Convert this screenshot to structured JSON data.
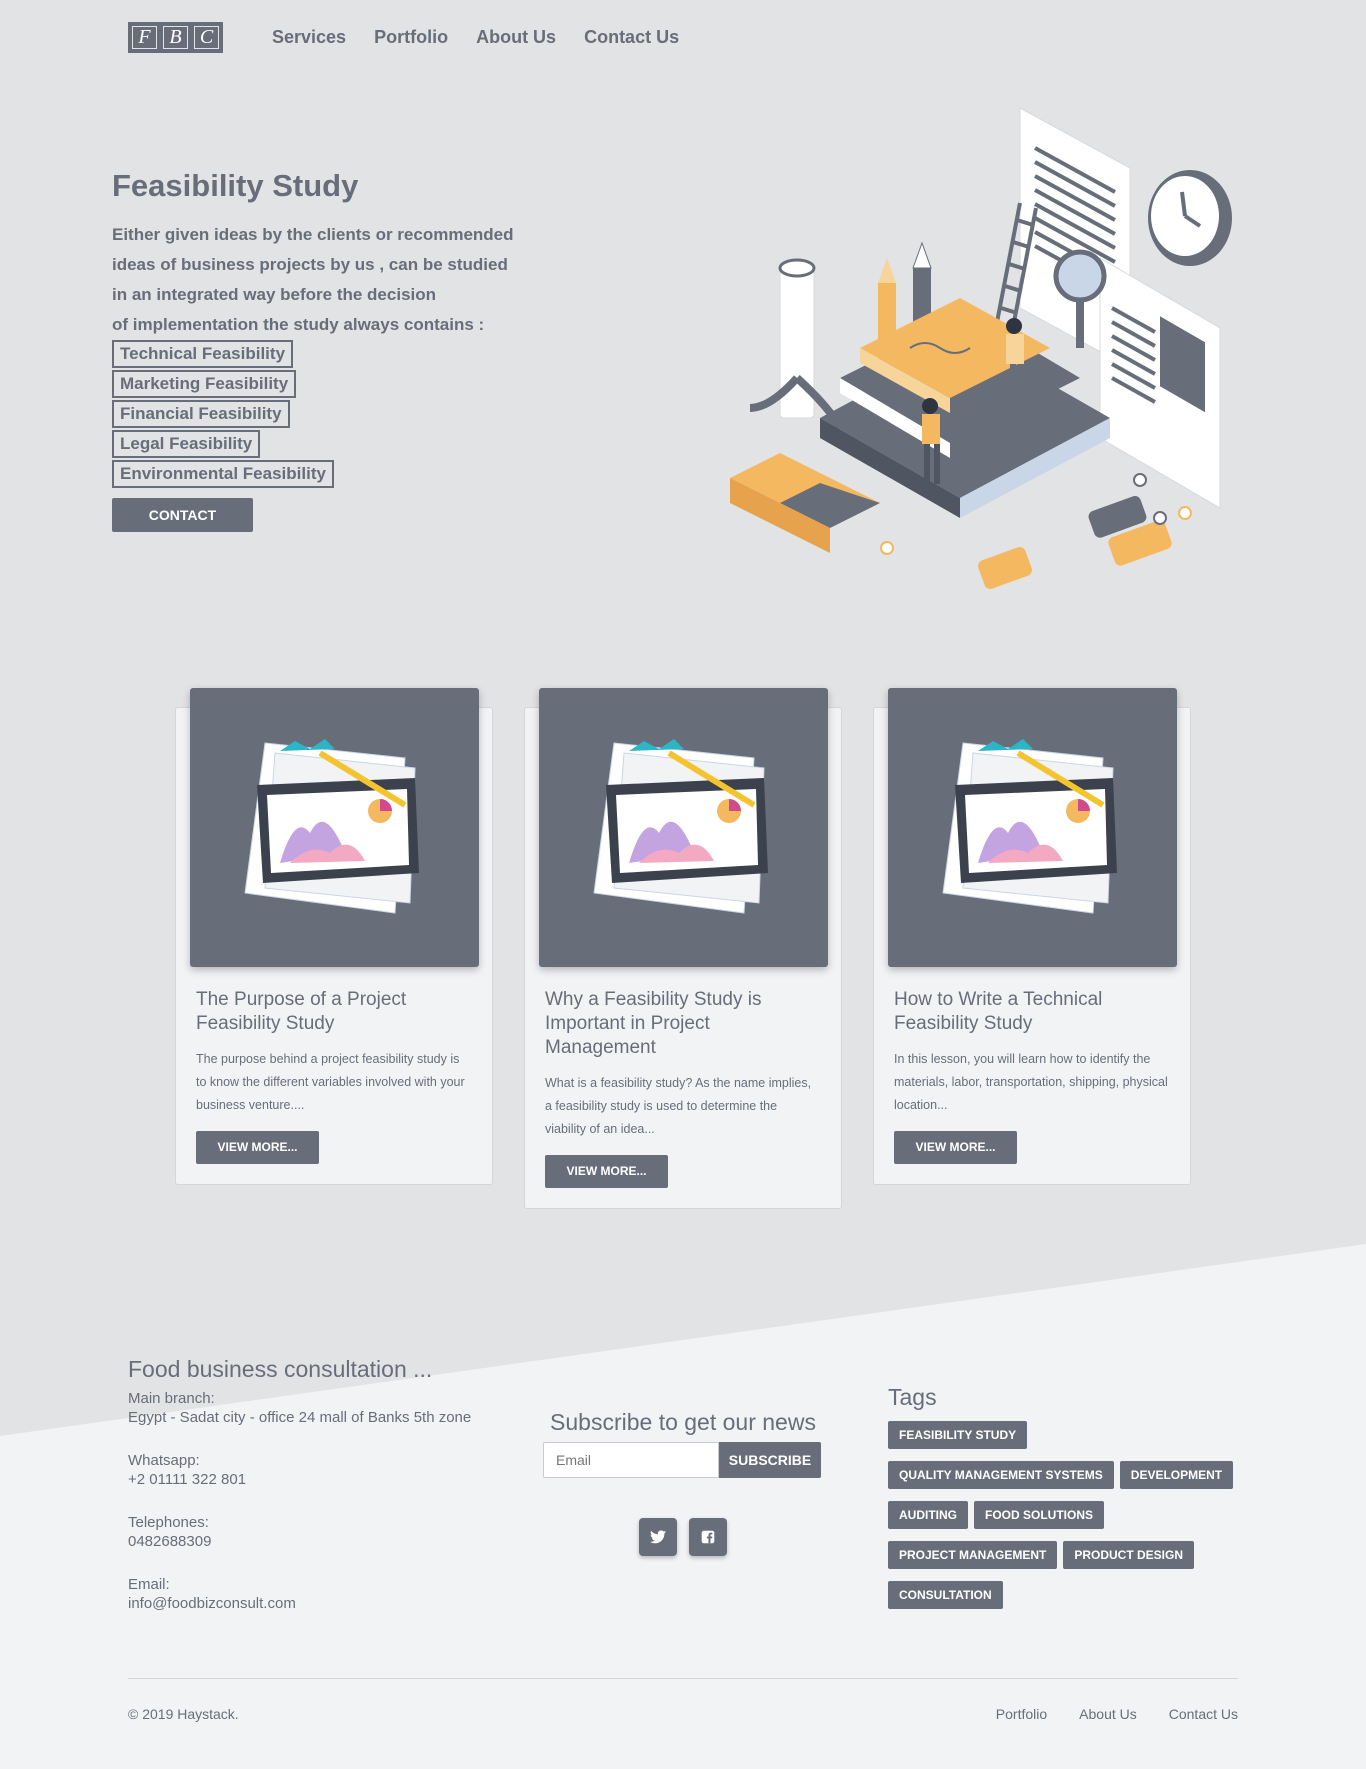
{
  "nav": {
    "logo_letters": [
      "F",
      "B",
      "C"
    ],
    "links": [
      "Services",
      "Portfolio",
      "About Us",
      "Contact Us"
    ]
  },
  "hero": {
    "title": "Feasibility Study",
    "lead_lines": [
      "Either given ideas by the clients or recommended",
      "ideas of business projects by us , can be studied",
      "in an integrated way before the decision",
      "of implementation the study always contains :"
    ],
    "features": [
      "Technical Feasibility",
      "Marketing Feasibility",
      "Financial Feasibility",
      "Legal Feasibility",
      "Environmental Feasibility"
    ],
    "contact_label": "CONTACT"
  },
  "cards": [
    {
      "title": "The Purpose of a Project Feasibility Study",
      "text": "The purpose behind a project feasibility study is to know the different variables involved with your business venture....",
      "button": "VIEW MORE..."
    },
    {
      "title": "Why a Feasibility Study is Important in Project Management",
      "text": "What is a feasibility study? As the name implies, a feasibility study is used to determine the viability of an idea...",
      "button": "VIEW MORE..."
    },
    {
      "title": "How to Write a Technical Feasibility Study",
      "text": "In this lesson, you will learn how to identify the materials, labor, transportation, shipping, physical location...",
      "button": "VIEW MORE..."
    }
  ],
  "footer": {
    "company": "Food business consultation ...",
    "main_branch_label": "Main branch:",
    "main_branch": "Egypt - Sadat city - office 24 mall of Banks 5th zone",
    "whatsapp_label": "Whatsapp:",
    "whatsapp": "+2 01111 322 801",
    "telephones_label": "Telephones:",
    "telephones": "0482688309",
    "email_label": "Email:",
    "email": "info@foodbizconsult.com",
    "subscribe_title": "Subscribe to get our news",
    "email_placeholder": "Email",
    "subscribe_button": "SUBSCRIBE",
    "tags_title": "Tags",
    "tags": [
      "FEASIBILITY STUDY",
      "QUALITY MANAGEMENT SYSTEMS",
      "DEVELOPMENT",
      "AUDITING",
      "FOOD SOLUTIONS",
      "PROJECT MANAGEMENT",
      "PRODUCT DESIGN",
      "CONSULTATION"
    ],
    "copyright": "© 2019 Haystack.",
    "links": [
      "Portfolio",
      "About Us",
      "Contact Us"
    ]
  },
  "colors": {
    "background": "#e2e3e5",
    "footer_background": "#f2f3f5",
    "primary": "#676e7a",
    "accent_orange": "#f4b860"
  }
}
